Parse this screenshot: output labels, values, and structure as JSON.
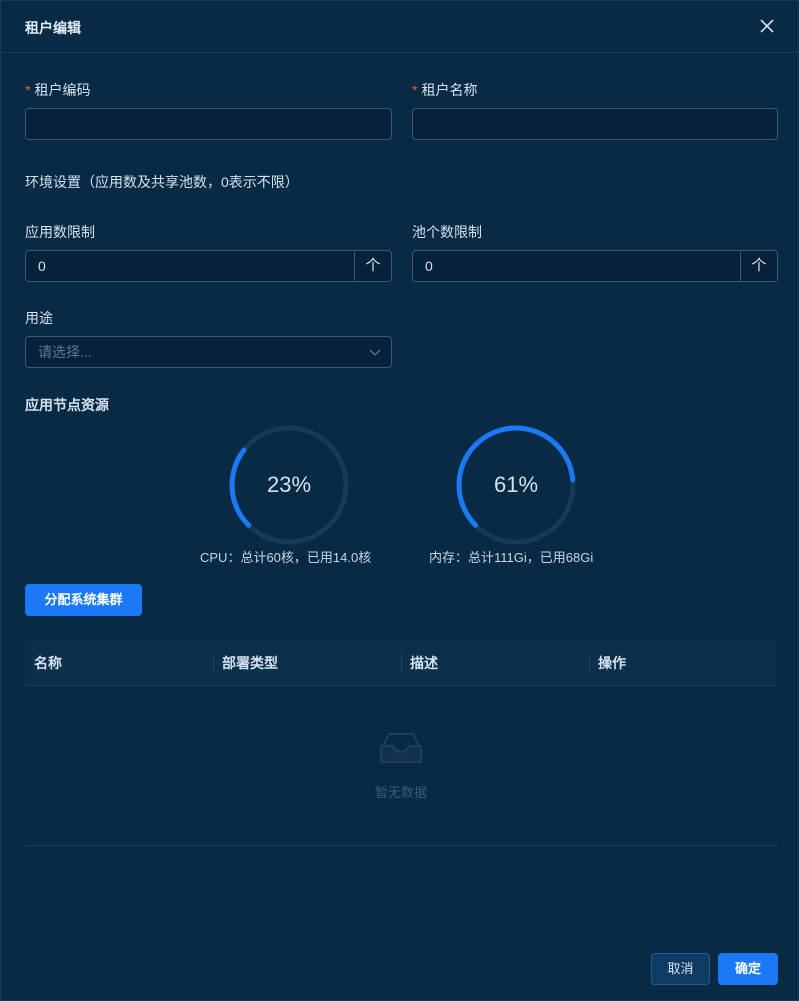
{
  "dialog": {
    "title": "租户编辑"
  },
  "form": {
    "tenant_code": {
      "label": "租户编码",
      "required_mark": "*",
      "value": ""
    },
    "tenant_name": {
      "label": "租户名称",
      "required_mark": "*",
      "value": ""
    },
    "env_settings_label": "环境设置（应用数及共享池数，0表示不限）",
    "app_limit": {
      "label": "应用数限制",
      "value": "0",
      "step_label": "个"
    },
    "pool_limit": {
      "label": "池个数限制",
      "value": "0",
      "step_label": "个"
    },
    "purpose": {
      "label": "用途",
      "placeholder": "请选择..."
    }
  },
  "resources": {
    "section_title": "应用节点资源",
    "cpu": {
      "percent": 23,
      "percent_label": "23%",
      "caption": "CPU：总计60核，已用14.0核"
    },
    "memory": {
      "percent": 61,
      "percent_label": "61%",
      "caption": "内存：总计111Gi，已用68Gi"
    }
  },
  "assign_button_label": "分配系统集群",
  "table": {
    "columns": [
      "名称",
      "部署类型",
      "描述",
      "操作"
    ],
    "empty_text": "暂无数据"
  },
  "footer": {
    "cancel_label": "取消",
    "confirm_label": "确定"
  },
  "colors": {
    "accent": "#1a7af5",
    "required": "#f5523c",
    "background": "#092a44"
  }
}
